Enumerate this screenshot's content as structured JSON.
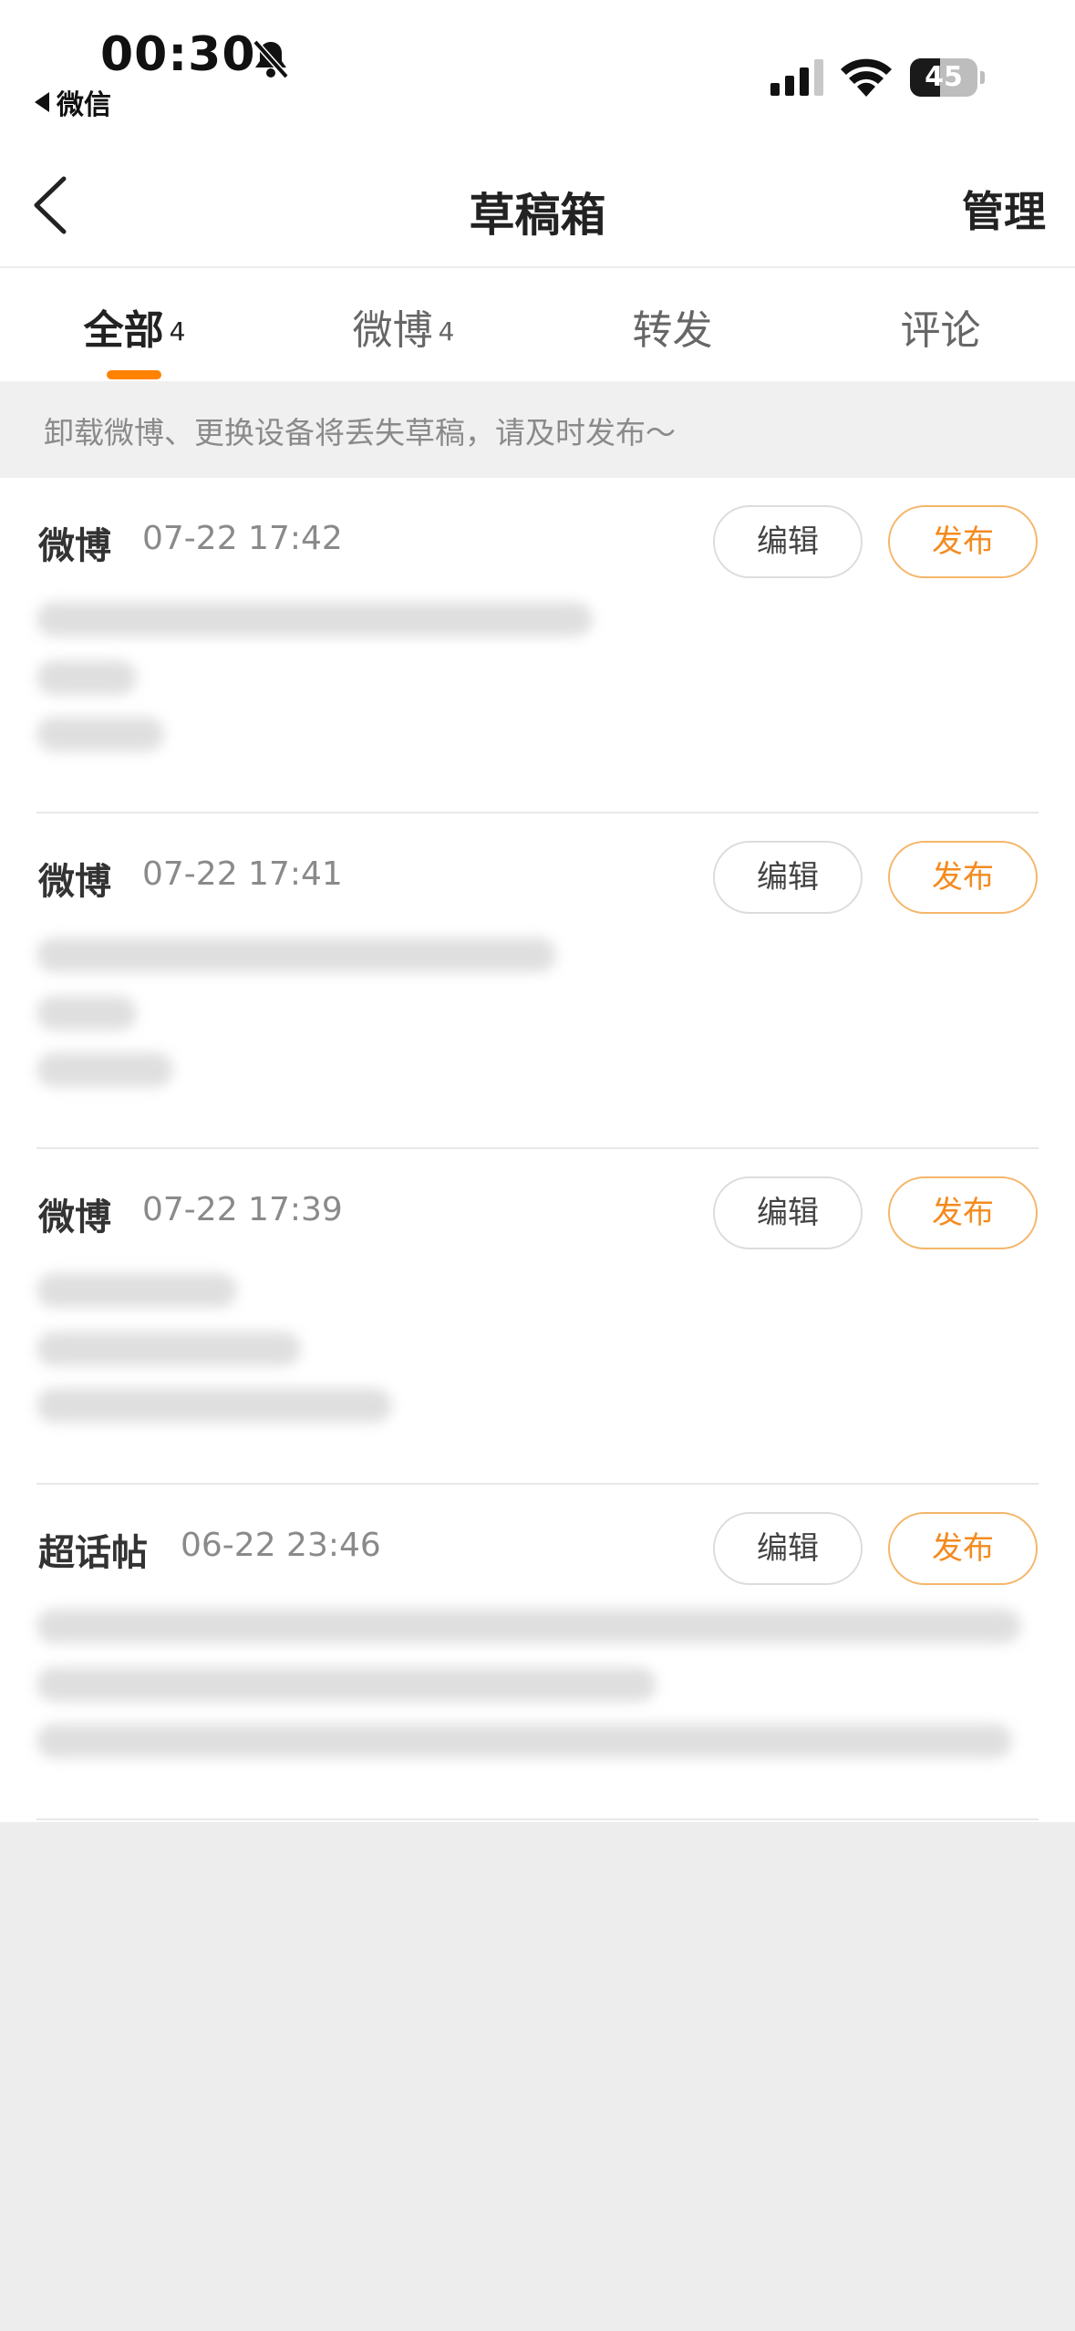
{
  "status_bar": {
    "time": "00:30",
    "back_app": "微信",
    "battery_level": "45"
  },
  "nav": {
    "title": "草稿箱",
    "manage": "管理"
  },
  "tabs": [
    {
      "label": "全部",
      "count": "4"
    },
    {
      "label": "微博",
      "count": "4"
    },
    {
      "label": "转发",
      "count": ""
    },
    {
      "label": "评论",
      "count": ""
    }
  ],
  "notice": "卸载微博、更换设备将丢失草稿，请及时发布～",
  "drafts": [
    {
      "type": "微博",
      "time": "07-22 17:42",
      "edit": "编辑",
      "publish": "发布"
    },
    {
      "type": "微博",
      "time": "07-22 17:41",
      "edit": "编辑",
      "publish": "发布"
    },
    {
      "type": "微博",
      "time": "07-22 17:39",
      "edit": "编辑",
      "publish": "发布"
    },
    {
      "type": "超话帖",
      "time": "06-22 23:46",
      "edit": "编辑",
      "publish": "发布"
    }
  ],
  "colors": {
    "accent": "#ff8200",
    "publish_text": "#f38b1f",
    "publish_border": "#f5b66a"
  },
  "icons": [
    "bell-muted-icon",
    "signal-icon",
    "wifi-icon",
    "battery-icon",
    "back-chevron-icon"
  ]
}
